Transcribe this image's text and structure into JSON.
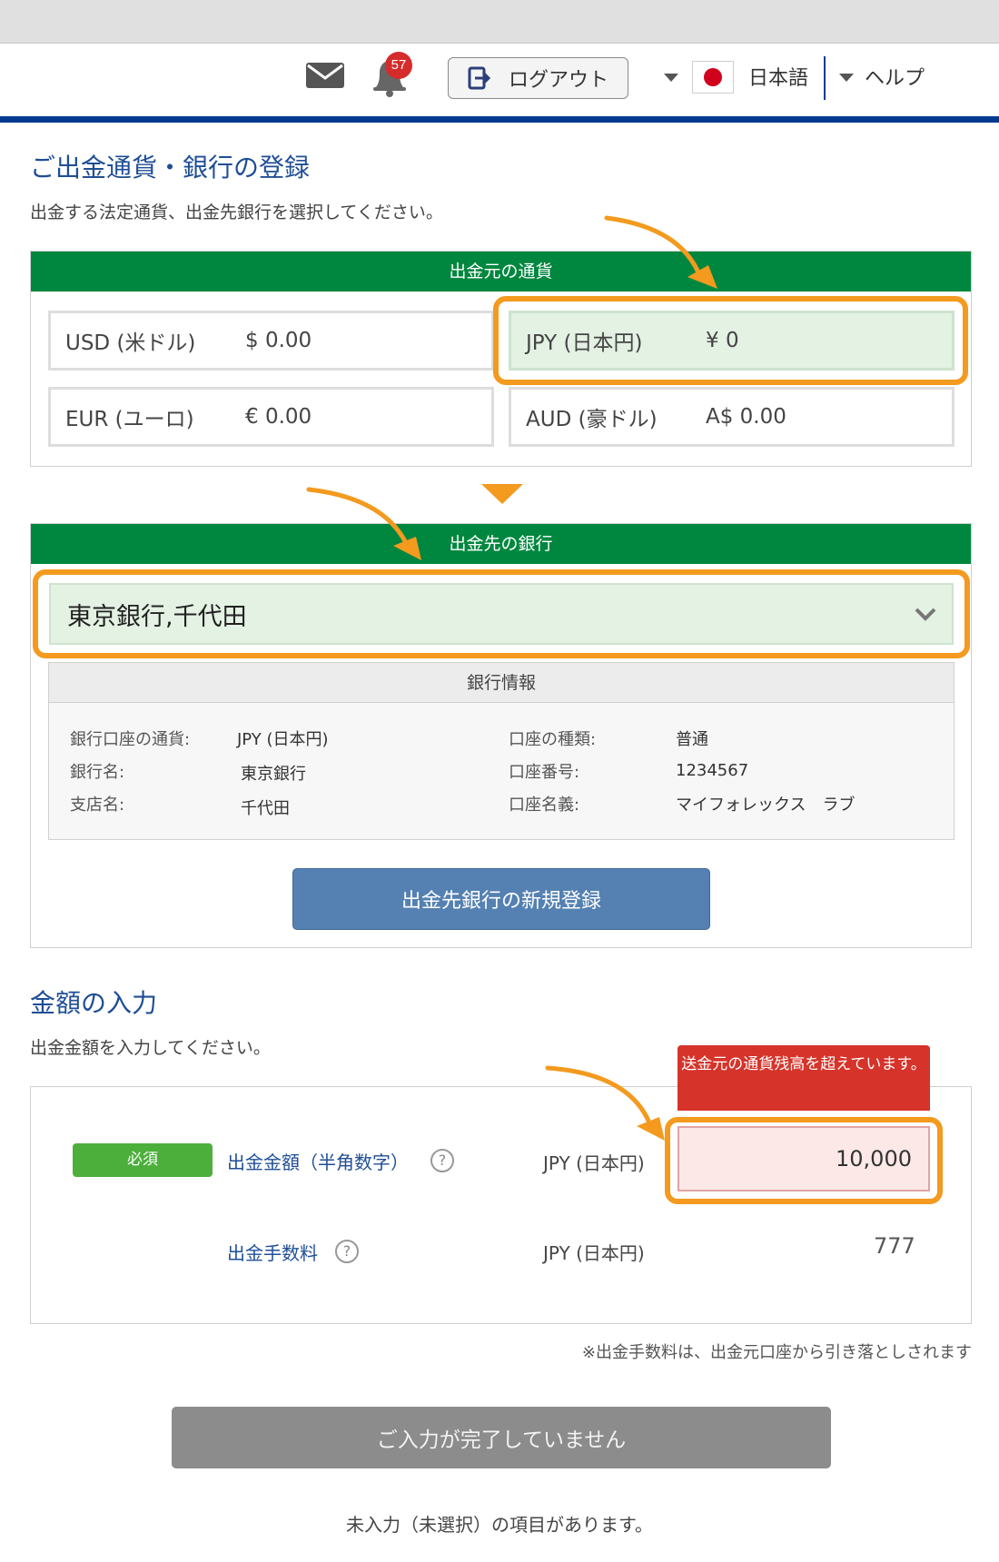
{
  "header": {
    "notification_count": "57",
    "logout_label": "ログアウト",
    "language_label": "日本語",
    "help_label": "ヘルプ",
    "icons": [
      "mail-icon",
      "bell-icon",
      "logout-icon",
      "japan-flag-icon",
      "caret-down-icon"
    ]
  },
  "currency_section": {
    "title": "ご出金通貨・銀行の登録",
    "subtitle": "出金する法定通貨、出金先銀行を選択してください。",
    "source_header": "出金元の通貨",
    "currencies": [
      {
        "code": "USD (米ドル)",
        "amount": "$ 0.00",
        "selected": false
      },
      {
        "code": "JPY (日本円)",
        "amount": "¥ 0",
        "selected": true
      },
      {
        "code": "EUR (ユーロ)",
        "amount": "€ 0.00",
        "selected": false
      },
      {
        "code": "AUD (豪ドル)",
        "amount": "A$ 0.00",
        "selected": false
      }
    ],
    "bank_header": "出金先の銀行",
    "selected_bank": "東京銀行,千代田",
    "bank_info": {
      "header": "銀行情報",
      "rows": [
        {
          "label": "銀行口座の通貨:",
          "value": "JPY (日本円)"
        },
        {
          "label": "銀行名:",
          "value": "東京銀行"
        },
        {
          "label": "支店名:",
          "value": "千代田"
        },
        {
          "label": "口座の種類:",
          "value": "普通"
        },
        {
          "label": "口座番号:",
          "value": "1234567"
        },
        {
          "label": "口座名義:",
          "value": "マイフォレックス　ラブ"
        }
      ]
    },
    "new_bank_button": "出金先銀行の新規登録"
  },
  "amount_section": {
    "title": "金額の入力",
    "subtitle": "出金金額を入力してください。",
    "required_badge": "必須",
    "amount_label": "出金金額（半角数字）",
    "amount_currency": "JPY (日本円)",
    "amount_value": "10,000",
    "error_message": "送金元の通貨残高を超えています。",
    "fee_label": "出金手数料",
    "fee_currency": "JPY (日本円)",
    "fee_value": "777",
    "note": "※出金手数料は、出金元口座から引き落としされます",
    "submit_label": "ご入力が完了していません",
    "incomplete_message": "未入力（未選択）の項目があります。"
  },
  "colors": {
    "section_header_green": "#00873f",
    "highlight_orange": "#f39a1f",
    "title_blue": "#1f4e96",
    "error_red": "#d6332a",
    "selected_bg": "#e3f2e3",
    "button_blue": "#5481b2",
    "disabled_gray": "#8c8c8c"
  }
}
